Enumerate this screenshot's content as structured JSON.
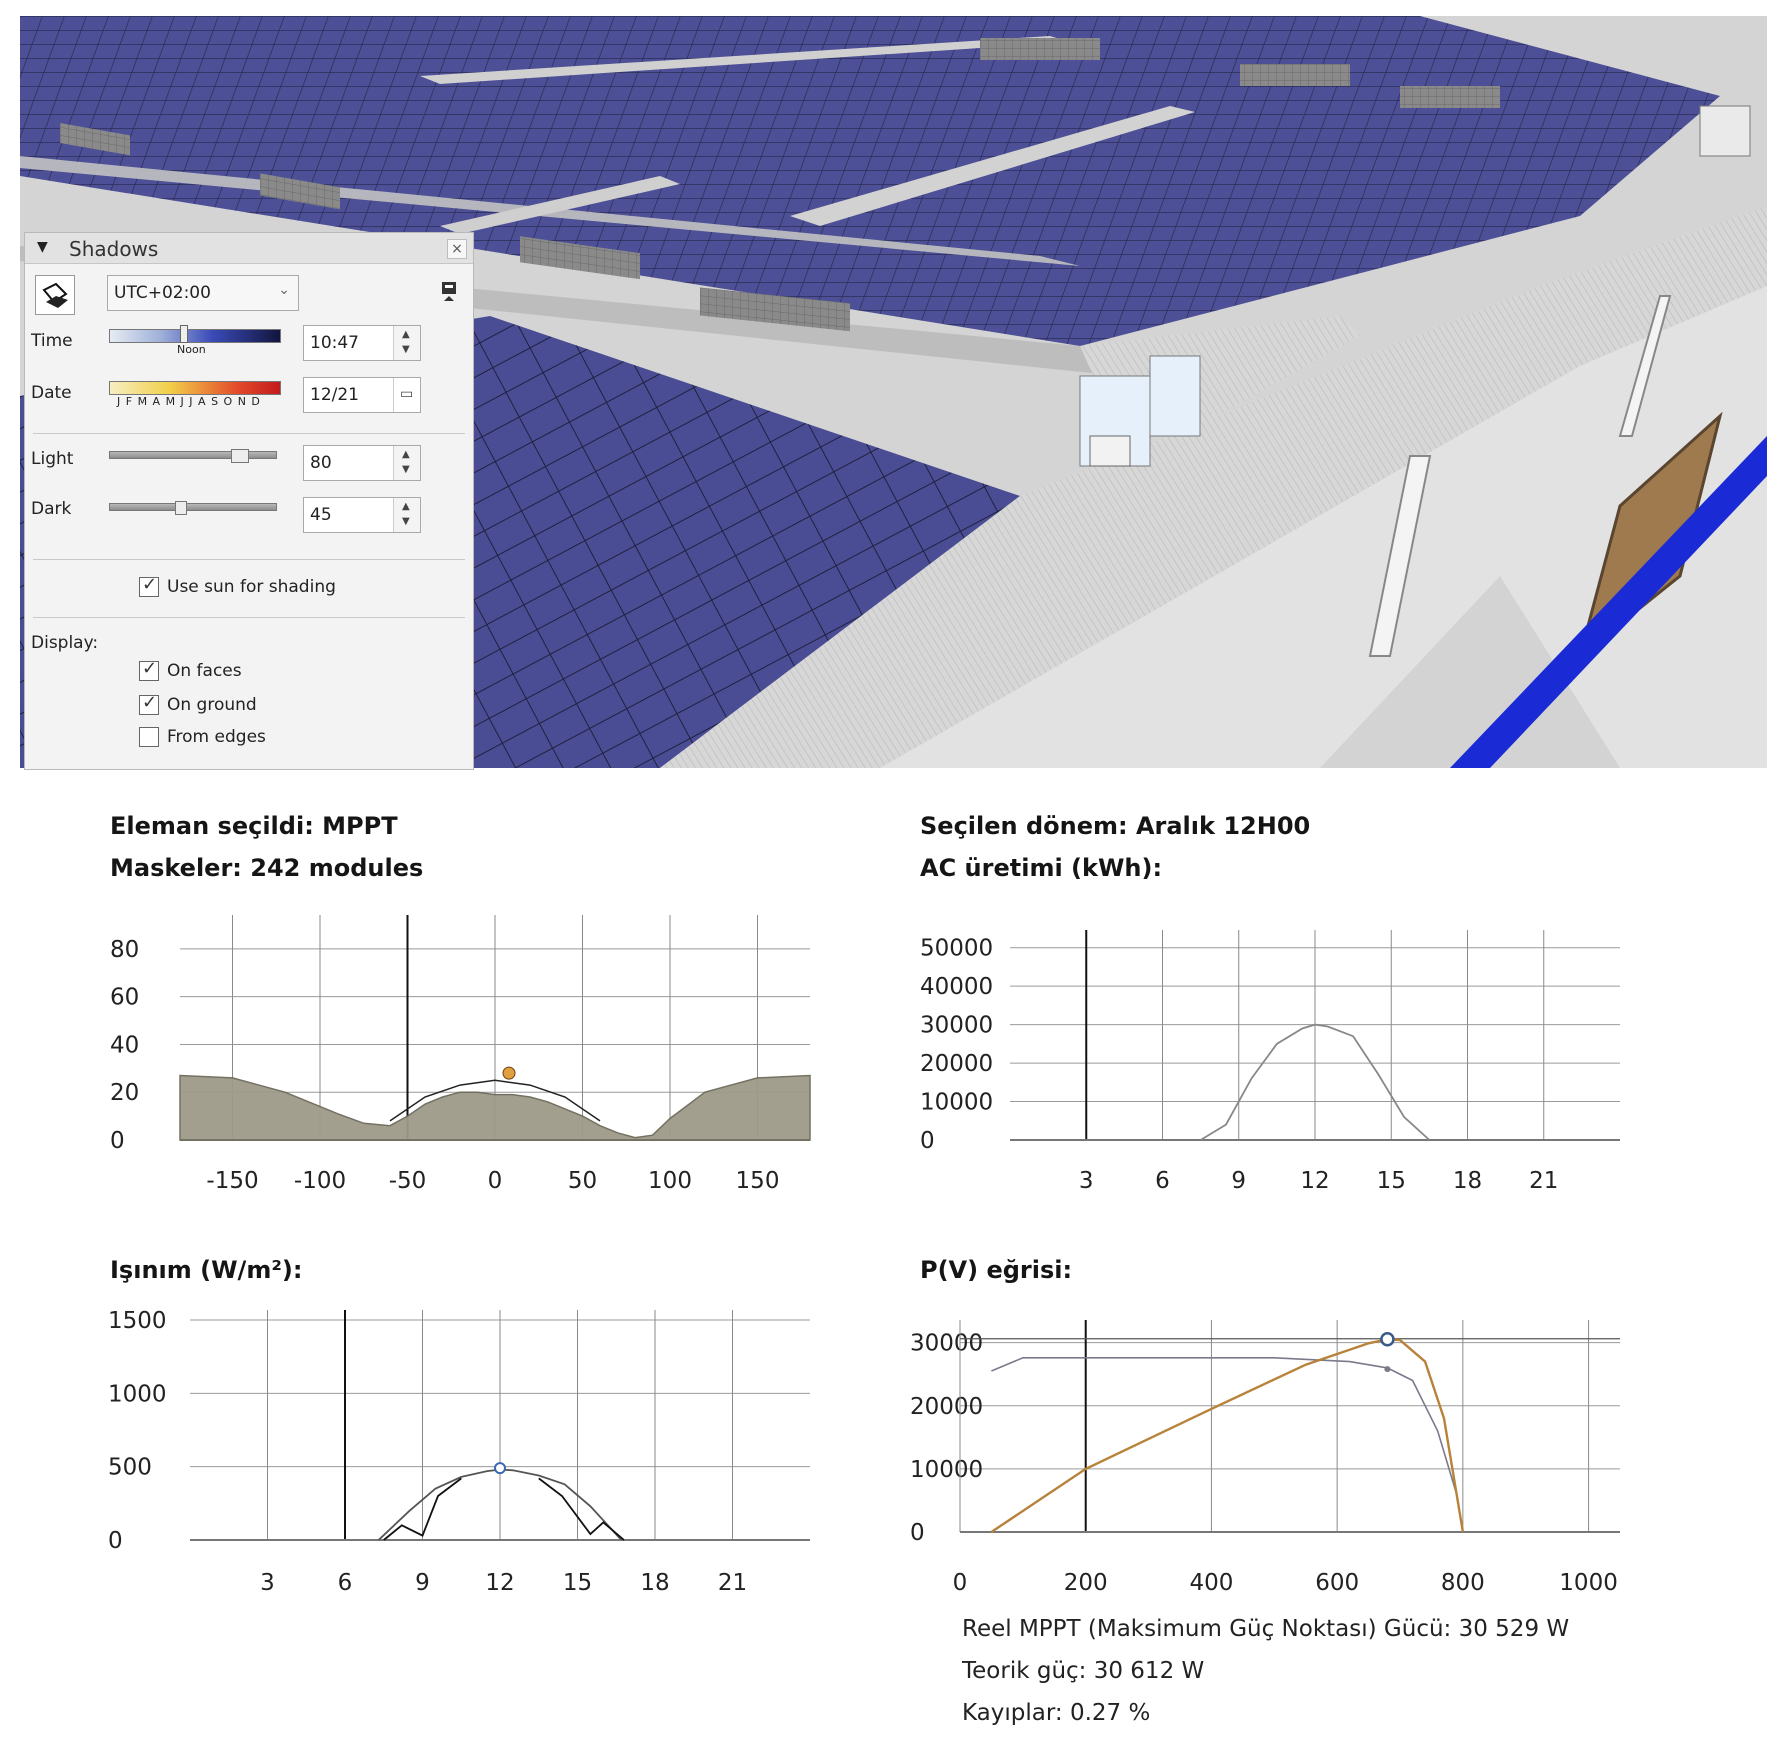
{
  "shadows_panel": {
    "title": "Shadows",
    "timezone": "UTC+02:00",
    "time_label": "Time",
    "time_slider_label": "Noon",
    "time_value": "10:47",
    "date_label": "Date",
    "date_slider_label": "J F M A M J J A S O N D",
    "date_value": "12/21",
    "light_label": "Light",
    "light_value": "80",
    "dark_label": "Dark",
    "dark_value": "45",
    "use_sun_label": "Use sun for shading",
    "use_sun_checked": true,
    "display_label": "Display:",
    "on_faces_label": "On faces",
    "on_faces_checked": true,
    "on_ground_label": "On ground",
    "on_ground_checked": true,
    "from_edges_label": "From edges",
    "from_edges_checked": false,
    "close_glyph": "×",
    "expand_glyph": "▼"
  },
  "info": {
    "element_selected": "Eleman seçildi: MPPT",
    "masks": "Maskeler: 242 modules",
    "selected_period": "Seçilen dönem: Aralık 12H00",
    "ac_production": "AC üretimi (kWh):",
    "irradiance": "Işınım (W/m²):",
    "pv_curve": "P(V) eğrisi:",
    "real_mppt": "Reel MPPT (Maksimum Güç Noktası) Gücü: 30 529 W",
    "theoretical": "Teorik güç: 30 612 W",
    "losses": "Kayıplar: 0.27 %"
  },
  "chart_data": [
    {
      "id": "horizon_mask",
      "type": "area",
      "title": "",
      "xlabel": "",
      "ylabel": "",
      "x_ticks": [
        "-150",
        "-100",
        "-50",
        "0",
        "50",
        "100",
        "150"
      ],
      "y_ticks": [
        "0",
        "20",
        "40",
        "60",
        "80"
      ],
      "xlim": [
        -180,
        180
      ],
      "ylim": [
        0,
        90
      ],
      "series": [
        {
          "x": [
            -180,
            -150,
            -120,
            -90,
            -75,
            -60,
            -50,
            -40,
            -30,
            -20,
            -10,
            0,
            10,
            20,
            30,
            40,
            50,
            60,
            70,
            80,
            90,
            100,
            120,
            150,
            180
          ],
          "y": [
            27,
            26,
            20,
            11,
            7,
            6,
            10,
            15,
            18,
            20,
            20,
            19,
            19,
            18,
            16,
            13,
            10,
            6,
            3,
            1,
            2,
            9,
            20,
            26,
            27
          ]
        }
      ],
      "sun_path": {
        "x": [
          -60,
          -40,
          -20,
          0,
          20,
          40,
          60
        ],
        "y": [
          8,
          18,
          23,
          25,
          23,
          18,
          8
        ]
      },
      "sun_marker": {
        "x": 8,
        "y": 28
      }
    },
    {
      "id": "ac_production",
      "type": "line",
      "title": "",
      "x_ticks": [
        "3",
        "6",
        "9",
        "12",
        "15",
        "18",
        "21"
      ],
      "y_ticks": [
        "0",
        "10000",
        "20000",
        "30000",
        "40000",
        "50000"
      ],
      "xlim": [
        0,
        24
      ],
      "ylim": [
        0,
        52000
      ],
      "series": [
        {
          "x": [
            7.5,
            8.5,
            9.5,
            10.5,
            11.5,
            12,
            12.5,
            13.5,
            14.5,
            15.5,
            16.5
          ],
          "y": [
            0,
            4000,
            16000,
            25000,
            29000,
            30000,
            29500,
            27000,
            17000,
            6000,
            0
          ]
        }
      ]
    },
    {
      "id": "irradiance",
      "type": "line",
      "title": "",
      "x_ticks": [
        "3",
        "6",
        "9",
        "12",
        "15",
        "18",
        "21"
      ],
      "y_ticks": [
        "0",
        "500",
        "1000",
        "1500"
      ],
      "xlim": [
        0,
        24
      ],
      "ylim": [
        0,
        1500
      ],
      "series": [
        {
          "x": [
            7.3,
            8.5,
            9.5,
            10.5,
            11.5,
            12,
            12.5,
            13.5,
            14.5,
            15.5,
            16.7
          ],
          "y": [
            0,
            200,
            350,
            430,
            470,
            480,
            475,
            440,
            380,
            230,
            0
          ]
        },
        {
          "x": [
            7.5,
            8.2,
            9.0,
            9.6,
            10.5
          ],
          "y": [
            0,
            100,
            30,
            300,
            420
          ]
        },
        {
          "x": [
            13.5,
            14.4,
            15.5,
            16.0,
            16.8
          ],
          "y": [
            420,
            300,
            40,
            120,
            0
          ]
        }
      ],
      "marker": {
        "x": 12,
        "y": 490
      }
    },
    {
      "id": "pv_curve",
      "type": "line",
      "title": "",
      "x_ticks": [
        "0",
        "200",
        "400",
        "600",
        "800",
        "1000"
      ],
      "y_ticks": [
        "0",
        "10000",
        "20000",
        "30000"
      ],
      "xlim": [
        0,
        1050
      ],
      "ylim": [
        0,
        32000
      ],
      "series": [
        {
          "name": "",
          "x": [
            50,
            200,
            400,
            550,
            650,
            680,
            700,
            740,
            770,
            790,
            800
          ],
          "y": [
            0,
            10000,
            19500,
            26500,
            29900,
            30529,
            30400,
            27000,
            18000,
            6000,
            0
          ]
        },
        {
          "name": "",
          "x": [
            50,
            100,
            300,
            500,
            620,
            680,
            720,
            760,
            790,
            800
          ],
          "y": [
            25500,
            27600,
            27600,
            27600,
            27000,
            26000,
            24000,
            16000,
            6000,
            0
          ]
        }
      ],
      "mpp_marker": {
        "x": 680,
        "y": 30529
      },
      "secondary_marker": {
        "x": 680,
        "y": 25800
      }
    }
  ],
  "colors": {
    "panel_blue": "#4a4d94",
    "panel_line": "#2b2c52",
    "roof_grey": "#c9c9c9",
    "wall_grey": "#dedede",
    "accent_blue": "#1a2bd6",
    "door_brown": "#a07a4f",
    "pv_curve_orange": "#b8823a"
  }
}
